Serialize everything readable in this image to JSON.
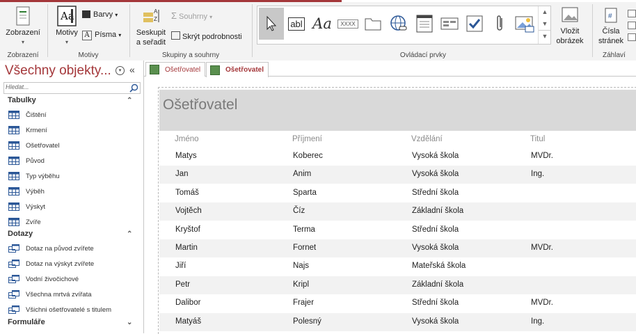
{
  "ribbon": {
    "groups": {
      "zobrazeni": {
        "label": "Zobrazení",
        "button": "Zobrazení"
      },
      "motivy": {
        "label": "Motivy",
        "button": "Motivy",
        "barvy": "Barvy",
        "pisma": "Písma"
      },
      "skupiny": {
        "label": "Skupiny a souhrny",
        "seskupit": "Seskupit a seřadit",
        "souhrny": "Souhrny",
        "skryt": "Skrýt podrobnosti"
      },
      "ovladaci": {
        "label": "Ovládací prvky",
        "vlozit": "Vložit obrázek",
        "gallery_text_label": "abl",
        "gallery_xxxx": "XXXX"
      },
      "zahlavi": {
        "label": "Záhlaví",
        "cisla": "Čísla stránek"
      }
    }
  },
  "nav": {
    "title": "Všechny objekty...",
    "search_placeholder": "Hledat...",
    "sections": [
      {
        "label": "Tabulky",
        "items": [
          "Čištění",
          "Krmení",
          "Ošetřovatel",
          "Původ",
          "Typ výběhu",
          "Výběh",
          "Výskyt",
          "Zvíře"
        ]
      },
      {
        "label": "Dotazy",
        "items": [
          "Dotaz na původ zvířete",
          "Dotaz na výskyt zvířete",
          "Vodní živočichové",
          "Všechna mrtvá zvířata",
          "Všichni ošetřovatelé s titulem"
        ]
      },
      {
        "label": "Formuláře",
        "items": []
      }
    ]
  },
  "tabs": [
    {
      "label": "Ošetřovatel",
      "active": false
    },
    {
      "label": "Ošetřovatel",
      "active": true
    }
  ],
  "report": {
    "title": "Ošetřovatel",
    "columns": [
      "Jméno",
      "Příjmení",
      "Vzdělání",
      "Titul"
    ],
    "rows": [
      [
        "Matys",
        "Koberec",
        "Vysoká škola",
        "MVDr."
      ],
      [
        "Jan",
        "Anim",
        "Vysoká škola",
        "Ing."
      ],
      [
        "Tomáš",
        "Sparta",
        "Střední škola",
        ""
      ],
      [
        "Vojtěch",
        "Číz",
        "Základní škola",
        ""
      ],
      [
        "Kryštof",
        "Terma",
        "Střední škola",
        ""
      ],
      [
        "Martin",
        "Fornet",
        "Vysoká škola",
        "MVDr."
      ],
      [
        "Jiří",
        "Najs",
        "Mateřská škola",
        ""
      ],
      [
        "Petr",
        "Kripl",
        "Základní škola",
        ""
      ],
      [
        "Dalibor",
        "Frajer",
        "Střední škola",
        "MVDr."
      ],
      [
        "Matyáš",
        "Polesný",
        "Vysoká škola",
        "Ing."
      ]
    ]
  },
  "colors": {
    "accent": "#a4373a",
    "ribbon_bg": "#f3f3f3",
    "header_band": "#d9d9d9",
    "alt_row": "#f2f2f2"
  }
}
